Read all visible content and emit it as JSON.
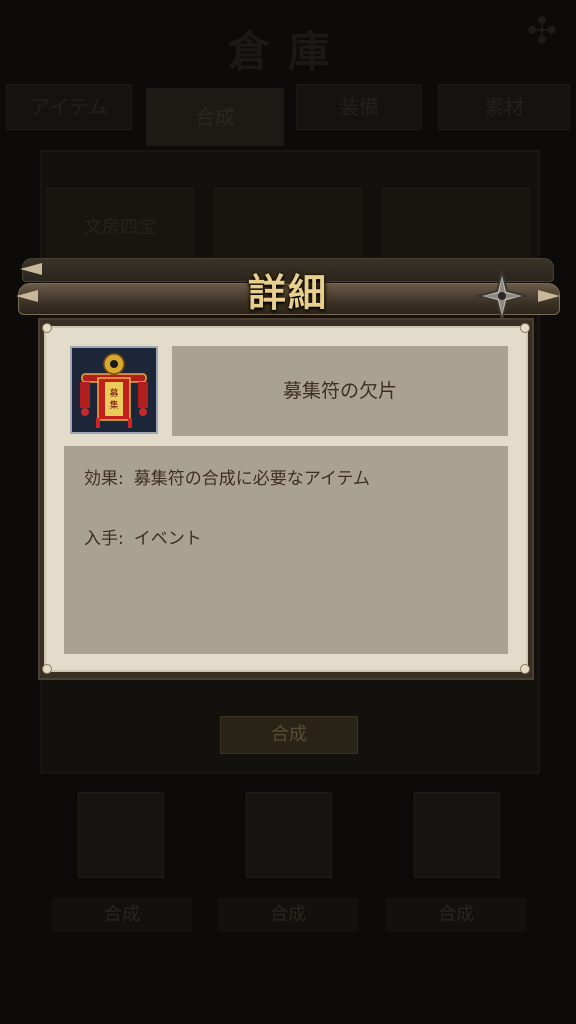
{
  "background": {
    "title": "倉庫",
    "tabs": [
      "アイテム",
      "合成",
      "装備",
      "素材"
    ],
    "cards": [
      "文房四宝"
    ],
    "compose_label": "合成",
    "slot_labels": [
      "合成",
      "合成",
      "合成"
    ]
  },
  "dialog": {
    "title": "詳細",
    "item_name": "募集符の欠片",
    "effect_label": "効果:",
    "effect_value": "募集符の合成に必要なアイテム",
    "obtain_label": "入手:",
    "obtain_value": "イベント"
  },
  "icons": {
    "close": "shuriken-icon",
    "item": "recruit-banner-icon"
  },
  "colors": {
    "title_gold": "#e8cf8e",
    "body_bg": "#e3dccb",
    "box_bg": "#a9a291",
    "text_brown": "#3f2e22"
  }
}
